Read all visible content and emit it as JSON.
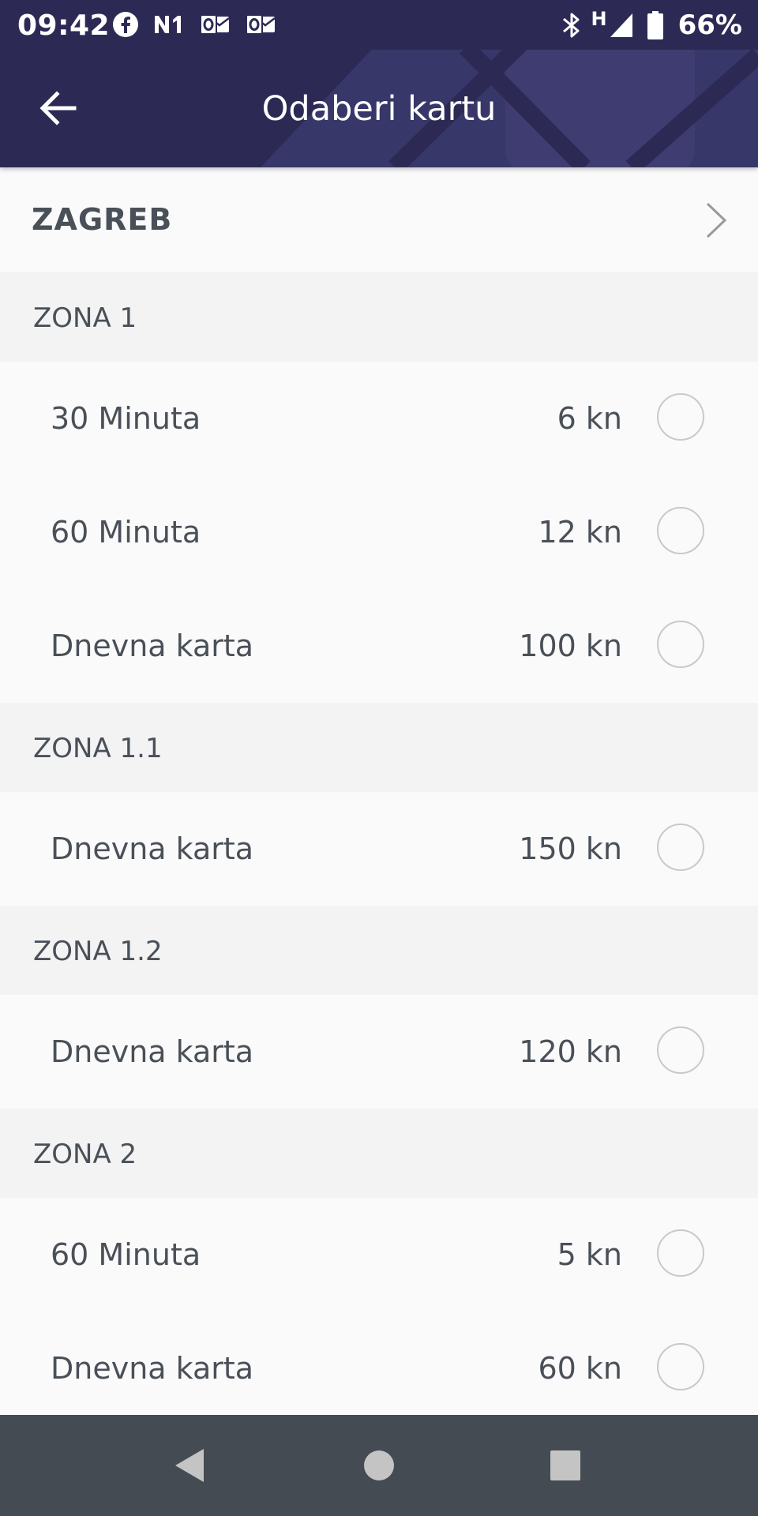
{
  "status_bar": {
    "time": "09:42",
    "network_type": "H",
    "battery_percent": "66%",
    "left_icons": [
      "facebook-icon",
      "n1-app-icon",
      "outlook-icon",
      "outlook-icon"
    ],
    "right_icons": [
      "bluetooth-icon",
      "cell-signal-icon",
      "battery-icon"
    ]
  },
  "appbar": {
    "title": "Odaberi kartu",
    "back_icon": "arrow-left-icon",
    "background_color": "#2c2a55"
  },
  "city": {
    "name": "ZAGREB",
    "chevron_icon": "chevron-right-icon"
  },
  "zones": [
    {
      "label": "ZONA 1",
      "tickets": [
        {
          "name": "30 Minuta",
          "price": "6 kn",
          "selected": false
        },
        {
          "name": "60 Minuta",
          "price": "12 kn",
          "selected": false
        },
        {
          "name": "Dnevna karta",
          "price": "100 kn",
          "selected": false
        }
      ]
    },
    {
      "label": "ZONA 1.1",
      "tickets": [
        {
          "name": "Dnevna karta",
          "price": "150 kn",
          "selected": false
        }
      ]
    },
    {
      "label": "ZONA 1.2",
      "tickets": [
        {
          "name": "Dnevna karta",
          "price": "120 kn",
          "selected": false
        }
      ]
    },
    {
      "label": "ZONA 2",
      "tickets": [
        {
          "name": "60 Minuta",
          "price": "5 kn",
          "selected": false
        },
        {
          "name": "Dnevna karta",
          "price": "60 kn",
          "selected": false
        }
      ]
    }
  ],
  "nav_bar": {
    "buttons": [
      "back-triangle-icon",
      "home-circle-icon",
      "recents-square-icon"
    ],
    "color": "#454b52"
  },
  "colors": {
    "primary": "#2c2a55",
    "text": "#4a5058",
    "zone_header_bg": "#f3f3f3",
    "row_bg": "#fafafa",
    "radio_border": "#c9c9c9"
  }
}
